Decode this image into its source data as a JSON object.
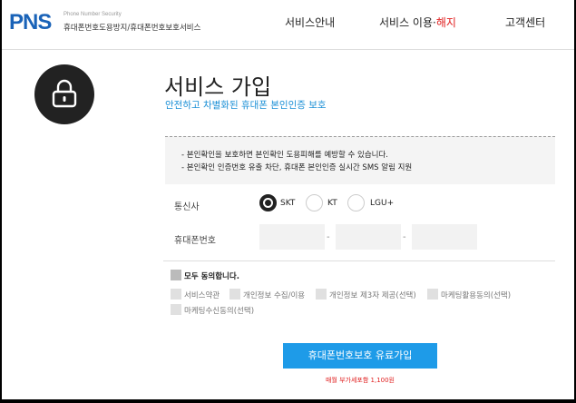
{
  "header": {
    "logo": "PNS",
    "logo_sub_en": "Phone Number Security",
    "logo_sub_ko": "휴대폰번호도용방지/휴대폰번호보호서비스",
    "nav": {
      "service_info": "서비스안내",
      "service_use": "서비스 이용·",
      "service_cancel": "해지",
      "support": "고객센터"
    }
  },
  "main": {
    "title": "서비스 가입",
    "subtitle": "안전하고 차별화된 휴대폰 본인인증 보호",
    "notice": [
      "- 본인확인을 보호하면 본인확인 도용피해를 예방할 수 있습니다.",
      "- 본인확인 인증번호 유출 차단, 휴대폰 본인인증 실시간 SMS 알림 지원"
    ],
    "carrier_label": "통신사",
    "carriers": [
      "SKT",
      "KT",
      "LGU+"
    ],
    "selected_carrier": "SKT",
    "phone_label": "휴대폰번호",
    "phone_values": [
      "",
      "",
      ""
    ],
    "agree_all": "모두 동의합니다.",
    "agreements": [
      "서비스약관",
      "개인정보 수집/이용",
      "개인정보 제3자 제공(선택)",
      "마케팅활용동의(선택)",
      "마케팅수신동의(선택)"
    ],
    "join_button": "휴대폰번호보호 유료가입",
    "price_note": "매월 부가세포함 1,100원"
  },
  "colors": {
    "brand": "#1a63b8",
    "accent": "#1e9be8",
    "highlight": "#e02020"
  }
}
